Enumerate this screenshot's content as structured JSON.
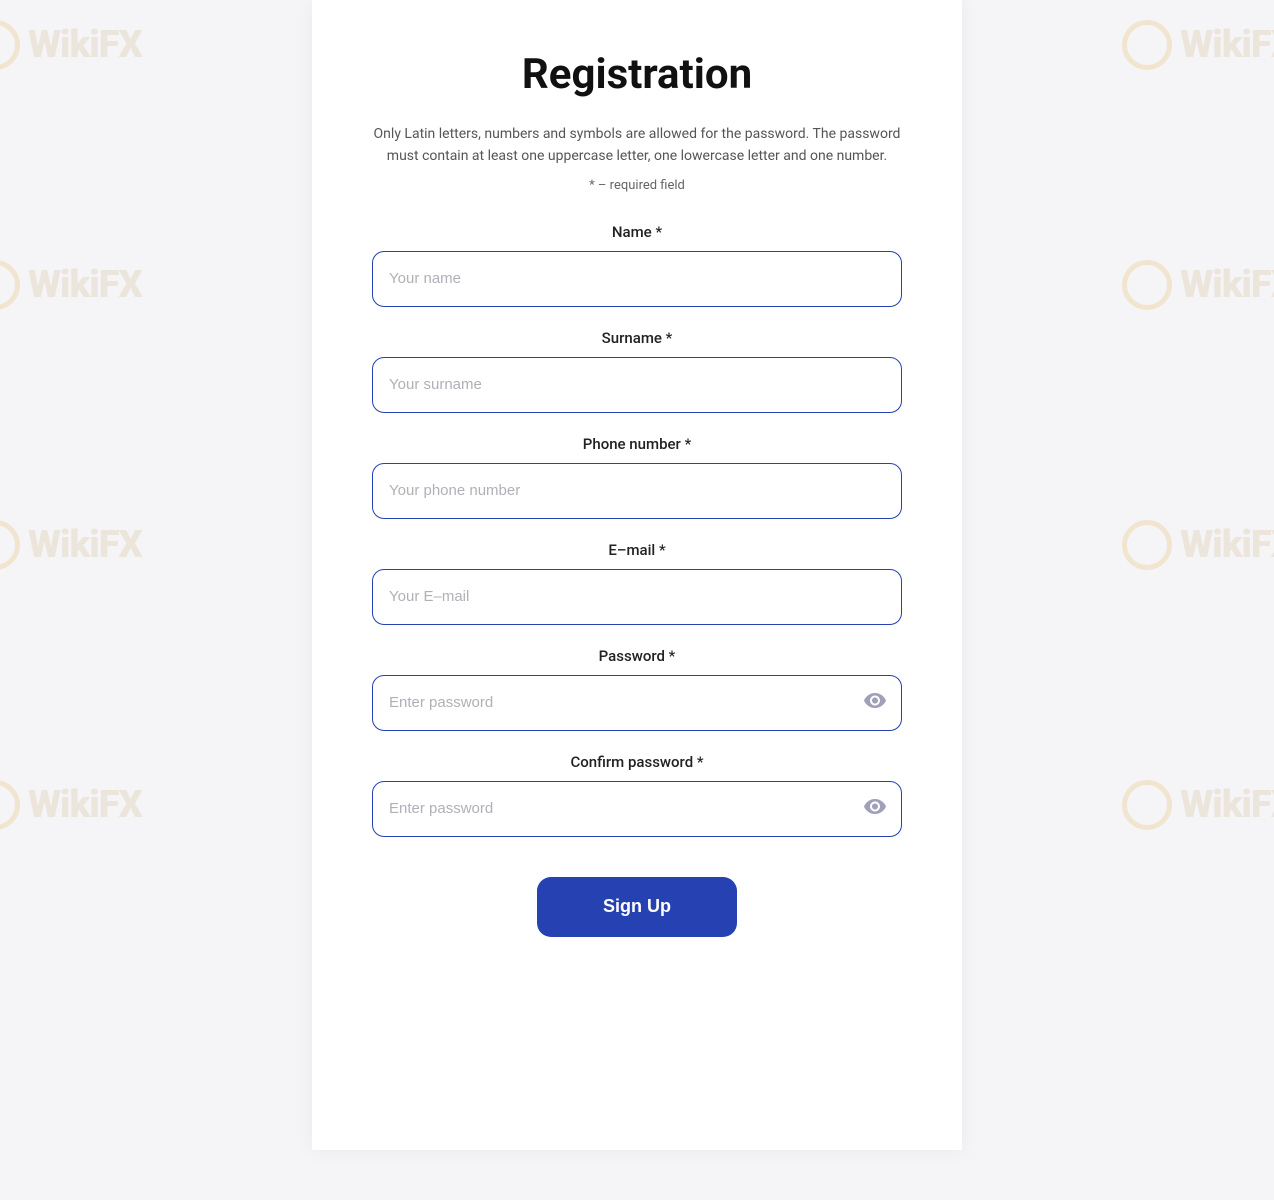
{
  "page": {
    "title": "Registration",
    "description": "Only Latin letters, numbers and symbols are allowed for the password. The password must contain at least one uppercase letter, one lowercase letter and one number.",
    "required_note": "* – required field"
  },
  "form": {
    "name_label": "Name *",
    "name_placeholder": "Your name",
    "surname_label": "Surname *",
    "surname_placeholder": "Your surname",
    "phone_label": "Phone number *",
    "phone_placeholder": "Your phone number",
    "email_label": "E–mail *",
    "email_placeholder": "Your E–mail",
    "password_label": "Password *",
    "password_placeholder": "Enter password",
    "confirm_password_label": "Confirm password *",
    "confirm_password_placeholder": "Enter password"
  },
  "buttons": {
    "signup_label": "Sign Up"
  },
  "colors": {
    "border": "#2541b2",
    "btn_bg": "#2541b2",
    "btn_text": "#ffffff"
  }
}
